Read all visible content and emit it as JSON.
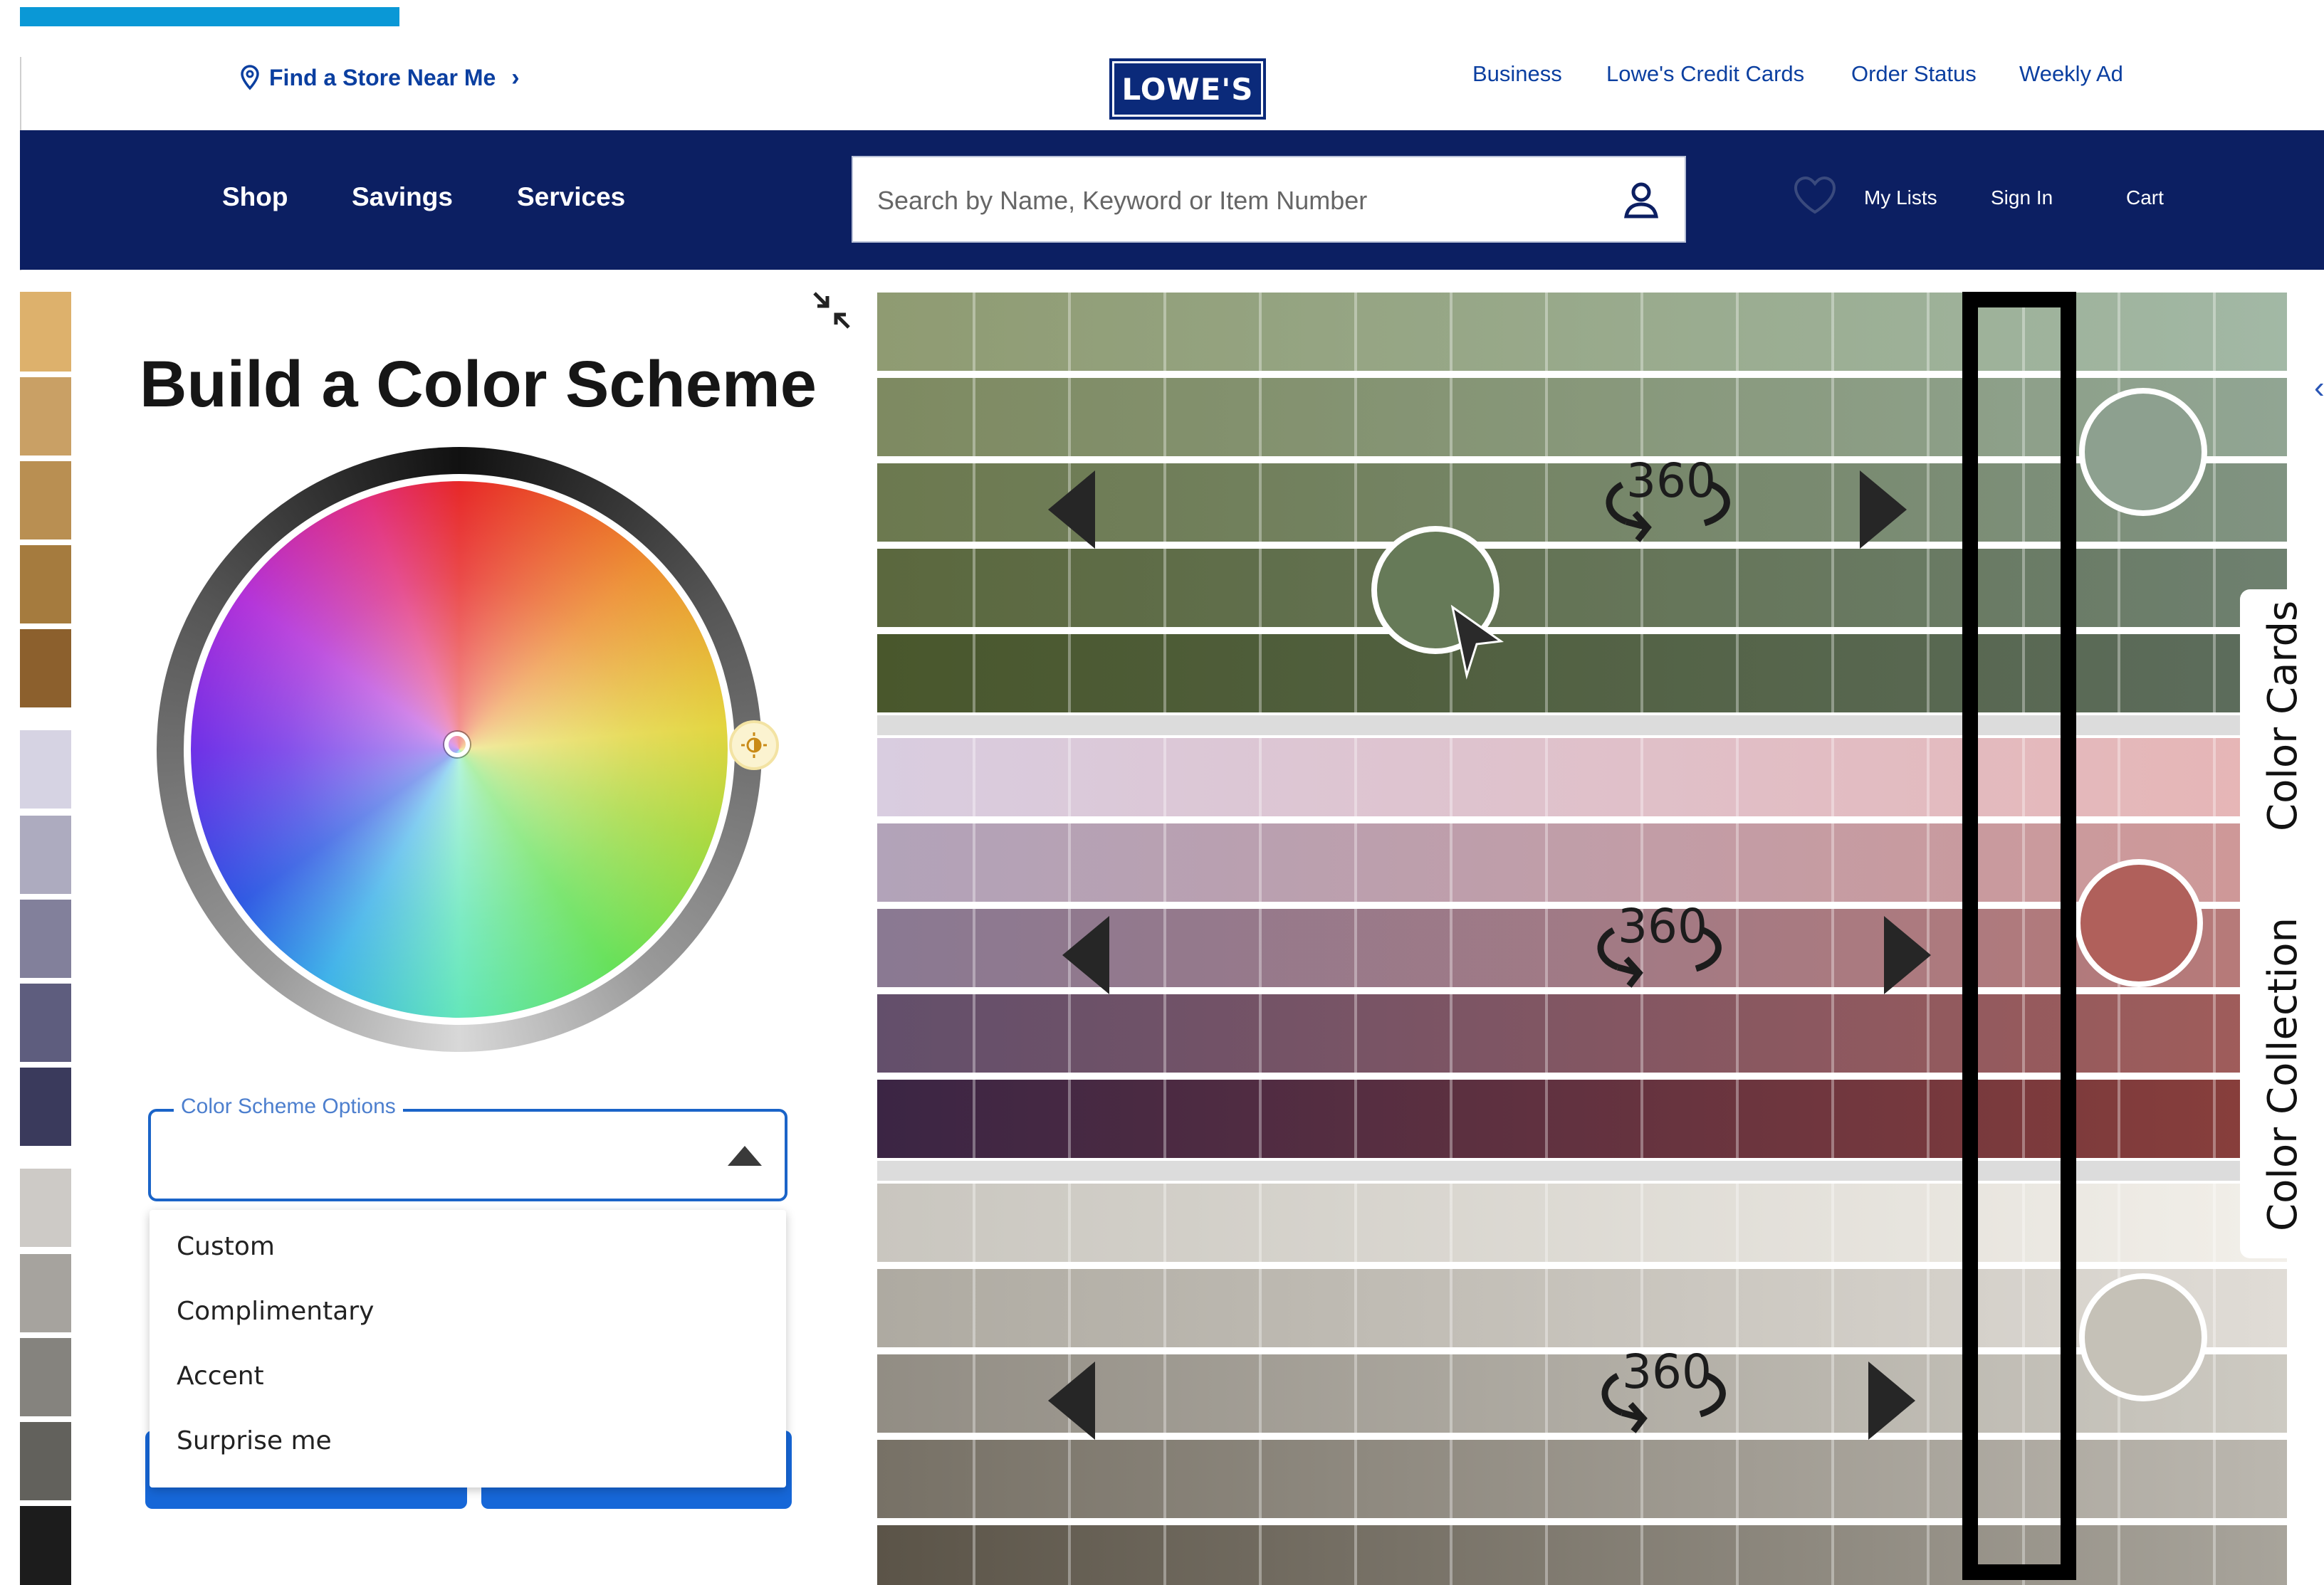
{
  "header": {
    "find_store": "Find a Store Near Me",
    "logo": "LOWE'S",
    "links": [
      "Business",
      "Lowe's Credit Cards",
      "Order Status",
      "Weekly Ad"
    ]
  },
  "nav": {
    "items": [
      "Shop",
      "Savings",
      "Services"
    ],
    "search_placeholder": "Search by Name, Keyword or Item Number",
    "my_lists": "My Lists",
    "sign_in": "Sign In",
    "cart": "Cart"
  },
  "panel": {
    "title": "Build a Color Scheme",
    "select_label": "Color Scheme Options",
    "options": [
      "Custom",
      "Complimentary",
      "Accent",
      "Surprise me"
    ]
  },
  "swatches": {
    "spinner_label": "360",
    "side_tabs": [
      "Color Cards",
      "Color Collection"
    ],
    "families": [
      {
        "name": "green",
        "top_colors": [
          "#8f9b72",
          "#a2b8a5"
        ],
        "bottom_colors": [
          "#49572c",
          "#5d6d5d"
        ],
        "selected": "#8da08f"
      },
      {
        "name": "purple-red",
        "top_colors": [
          "#d9cde0",
          "#e6b5b5"
        ],
        "bottom_colors": [
          "#3b2544",
          "#8a3f3b"
        ],
        "selected": "#b0605b"
      },
      {
        "name": "neutral",
        "top_colors": [
          "#c9c6bf",
          "#f2efe9"
        ],
        "bottom_colors": [
          "#5b5448",
          "#a8a49b"
        ],
        "selected": "#c5c1b7"
      }
    ]
  },
  "colors": {
    "brand_blue": "#0c1f62",
    "link_blue": "#0b3fa0",
    "accent_blue": "#1667d8"
  }
}
